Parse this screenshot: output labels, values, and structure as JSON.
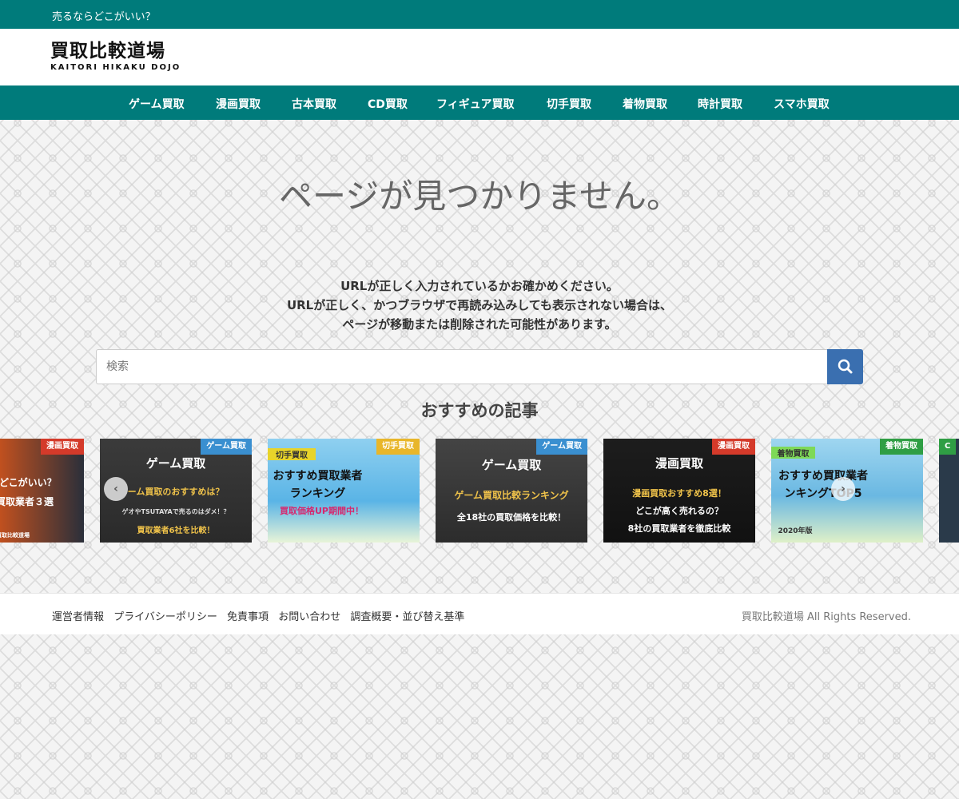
{
  "topbar": {
    "tagline": "売るならどこがいい？"
  },
  "header": {
    "logo_main": "買取比較道場",
    "logo_sub": "KAITORI HIKAKU DOJO"
  },
  "nav": {
    "items": [
      {
        "label": "ゲーム買取"
      },
      {
        "label": "漫画買取"
      },
      {
        "label": "古本買取"
      },
      {
        "label": "CD買取"
      },
      {
        "label": "フィギュア買取"
      },
      {
        "label": "切手買取"
      },
      {
        "label": "着物買取"
      },
      {
        "label": "時計買取"
      },
      {
        "label": "スマホ買取"
      }
    ]
  },
  "main": {
    "title": "ページが見つかりません。",
    "message_lines": [
      "URLが正しく入力されているかお確かめください。",
      "URLが正しく、かつブラウザで再読み込みしても表示されない場合は、",
      "ページが移動または削除された可能性があります。"
    ],
    "search": {
      "placeholder": "検索",
      "value": ""
    },
    "recommended_title": "おすすめの記事"
  },
  "cards": [
    {
      "badge": "漫画買取",
      "lines": [
        "ならどこがいい？",
        "買取業者３選",
        "",
        "買取比較道場"
      ]
    },
    {
      "badge": "ゲーム買取",
      "lines": [
        "ゲーム買取",
        "ーム買取のおすすめは？",
        "ゲオやTSUTAYAで売るのはダメ！？",
        "買取業者6社を比較！"
      ]
    },
    {
      "badge": "切手買取",
      "lines": [
        "切手買取",
        "おすすめ買取業者",
        "ランキング",
        "買取価格UP期間中！"
      ]
    },
    {
      "badge": "ゲーム買取",
      "lines": [
        "ゲーム買取",
        "ゲーム買取比較ランキング",
        "全18社の買取価格を比較！"
      ]
    },
    {
      "badge": "漫画買取",
      "lines": [
        "漫画買取",
        "漫画買取おすすめ8選！",
        "どこが高く売れるの？",
        "8社の買取業者を徹底比較"
      ]
    },
    {
      "badge": "着物買取",
      "lines": [
        "着物買取",
        "おすすめ買取業者",
        "ンキングTOP5",
        "2020年版"
      ]
    },
    {
      "badge": "C",
      "lines": []
    }
  ],
  "colors": {
    "brand": "#007b7b",
    "search_button": "#3a6fb0",
    "badge_red": "#d43a2a",
    "badge_blue": "#3a8fd0",
    "badge_yellow": "#e8b62a",
    "badge_green": "#2f9e44"
  },
  "footer": {
    "links": [
      {
        "label": "運営者情報"
      },
      {
        "label": "プライバシーポリシー"
      },
      {
        "label": "免責事項"
      },
      {
        "label": "お問い合わせ"
      },
      {
        "label": "調査概要・並び替え基準"
      }
    ],
    "copyright": "買取比較道場 All Rights Reserved."
  }
}
